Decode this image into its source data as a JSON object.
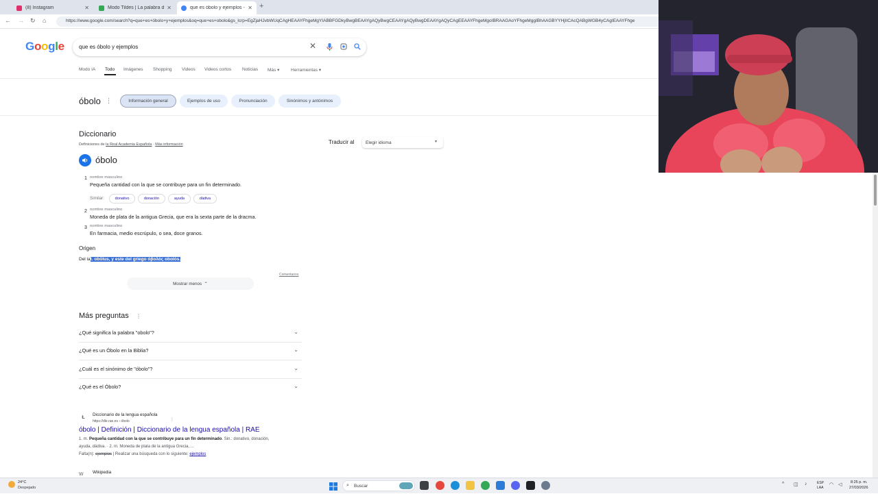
{
  "browser": {
    "tabs": [
      {
        "title": "(8) Instagram",
        "color": "#e1306c"
      },
      {
        "title": "Modo Tildes | La palabra del d",
        "color": "#34a853"
      },
      {
        "title": "que es óbolo y ejemplos - Busc",
        "color": "#4285f4"
      }
    ],
    "url": "https://www.google.com/search?q=que+es+óbolo+y+ejemplos&oq=que+es+obolo&gs_lcrp=EgZjaHJvbWUqCAgHEAAYFhgeMgYIABBFGDkyBwgBEAAYgAQyBwgCEAAYgAQyBwgDEAAYgAQyCAgEEAAYFhgeMgoIBRAAGAoYFhgeMggIBhAAGBYYHjIICAcQABgWGB4yCAgIEAAYFhge"
  },
  "google": {
    "logo_letters": [
      {
        "ch": "G",
        "color": "#4285f4"
      },
      {
        "ch": "o",
        "color": "#ea4335"
      },
      {
        "ch": "o",
        "color": "#fbbc05"
      },
      {
        "ch": "g",
        "color": "#4285f4"
      },
      {
        "ch": "l",
        "color": "#34a853"
      },
      {
        "ch": "e",
        "color": "#ea4335"
      }
    ],
    "query": "que es óbolo y ejemplos",
    "nav_tabs": [
      "Modo IA",
      "Todo",
      "Imágenes",
      "Shopping",
      "Videos",
      "Videos cortos",
      "Noticias",
      "Más",
      "Herramientas"
    ],
    "active_tab": "Todo"
  },
  "topic": {
    "word": "óbolo",
    "chips": [
      "Información general",
      "Ejemplos de uso",
      "Pronunciación",
      "Sinónimos y antónimos"
    ]
  },
  "dictionary": {
    "title": "Diccionario",
    "source_prefix": "Definiciones de ",
    "source_link": "la Real Academia Española",
    "more_info": "Más información",
    "headword": "óbolo",
    "senses": [
      {
        "num": "1",
        "pos": "nombre masculino",
        "def": "Pequeña cantidad con la que se contribuye para un fin determinado."
      },
      {
        "num": "2",
        "pos": "nombre masculino",
        "def": "Moneda de plata de la antigua Grecia, que era la sexta parte de la dracma."
      },
      {
        "num": "3",
        "pos": "nombre masculino",
        "def": "En farmacia, medio escrúpulo, o sea, doce granos."
      }
    ],
    "similar_label": "Similar:",
    "similar": [
      "donativo",
      "donación",
      "ayuda",
      "dádiva"
    ],
    "origin_title": "Origen",
    "origin_prefix": "Del la",
    "origin_selected": "t. obŏlus, y este del griego ὀβολός obolós.",
    "feedback": "Comentarios",
    "show_less": "Mostrar menos"
  },
  "translate": {
    "label": "Traducir al",
    "select": "Elegir idioma"
  },
  "paa": {
    "title": "Más preguntas",
    "questions": [
      "¿Qué significa la palabra \"obolo\"?",
      "¿Qué es un Óbolo en la Biblia?",
      "¿Cuál es el sinónimo de \"óbolo\"?",
      "¿Qué es el Óbolo?"
    ]
  },
  "result": {
    "site": "Diccionario de la lengua española",
    "url": "https://dle.rae.es › óbolo",
    "title": "óbolo | Definición | Diccionario de la lengua española | RAE",
    "snippet1_a": "1. m. ",
    "snippet1_b": "Pequeña cantidad con la que se contribuye para un fin determinado",
    "snippet1_c": ". Sin.: donativo, donación,",
    "snippet2": "ayuda, dádiva. · 2. m. Moneda de plata de la antigua Grecia, ...",
    "missing_prefix": "Falta(n): ",
    "missing_word": "ejemplos",
    "missing_mid": " | Realizar una búsqueda con lo siguiente: ",
    "missing_link": "ejemplos"
  },
  "wiki": {
    "site": "Wikipedia"
  },
  "taskbar": {
    "temp": "24°C",
    "weather": "Despejado",
    "search": "Buscar",
    "lang1": "ESP",
    "lang2": "LAA",
    "time": "8:25 p. m.",
    "date": "27/03/2026"
  }
}
